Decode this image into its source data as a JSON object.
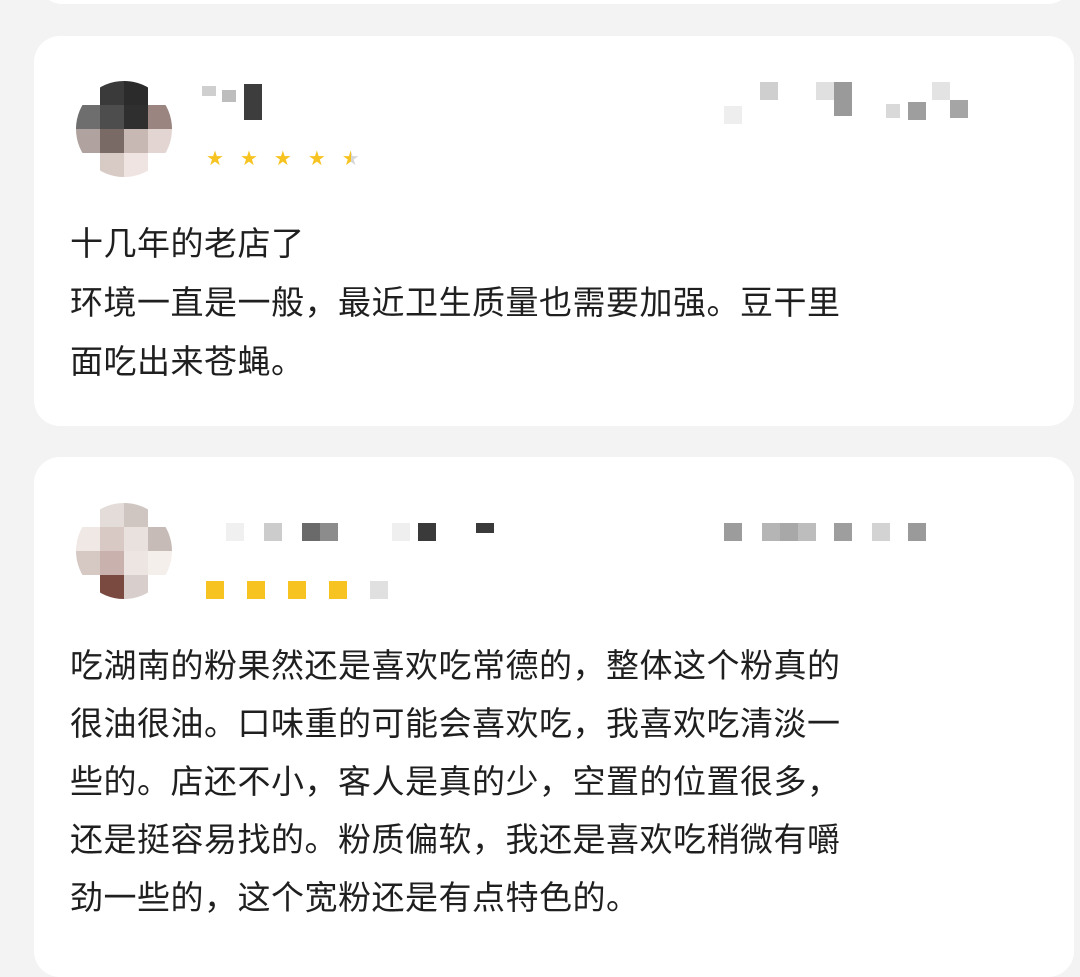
{
  "reviews": [
    {
      "rating": 4.5,
      "max_rating": 5,
      "text_lines": [
        "十几年的老店了",
        "环境一直是一般，最近卫生质量也需要加强。豆干里\n面吃出来苍蝇。"
      ],
      "avatar_colors": [
        "#ffffff",
        "#3a3a3a",
        "#2b2b2b",
        "#ffffff",
        "#6e6e6e",
        "#4d4d4d",
        "#2f2f2f",
        "#9a8580",
        "#b0a29e",
        "#7a6a66",
        "#c8b8b4",
        "#e3d6d2",
        "#ffffff",
        "#d8cbc6",
        "#efe4e1",
        "#ffffff"
      ],
      "star_color": "#f7c321",
      "star_empty_color": "#d6d6d6"
    },
    {
      "rating": 4,
      "max_rating": 5,
      "text_lines": [
        "吃湖南的粉果然还是喜欢吃常德的，整体这个粉真的\n很油很油。口味重的可能会喜欢吃，我喜欢吃清淡一\n些的。店还不小，客人是真的少，空置的位置很多，\n还是挺容易找的。粉质偏软，我还是喜欢吃稍微有嚼\n劲一些的，这个宽粉还是有点特色的。"
      ],
      "avatar_colors": [
        "#ffffff",
        "#e4dcd8",
        "#cfc6c2",
        "#ffffff",
        "#f0e8e4",
        "#d9c9c4",
        "#e9e1dd",
        "#c7bbb7",
        "#d6c9c4",
        "#c9b2ad",
        "#ede5e1",
        "#f5efec",
        "#ffffff",
        "#7a4a40",
        "#d8cfcc",
        "#ffffff"
      ],
      "star_color": "#f7c321",
      "star_empty_color": "#e0e0e0"
    }
  ]
}
